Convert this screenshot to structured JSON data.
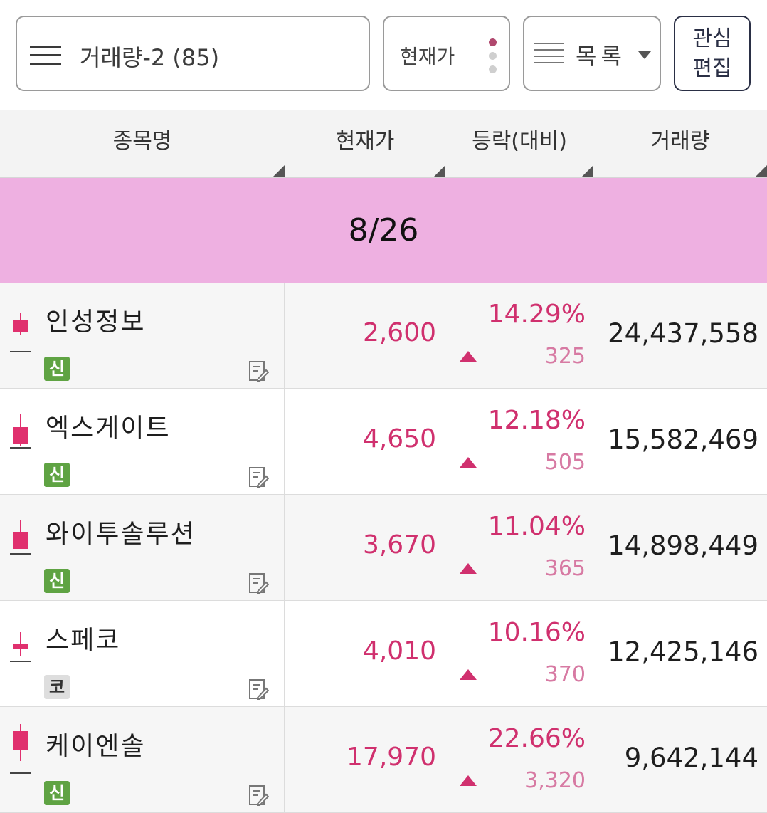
{
  "toolbar": {
    "group_label": "거래량-2 (85)",
    "price_label": "현재가",
    "view_label": "목록",
    "edit_label": "관심\n편집"
  },
  "table_header": {
    "name": "종목명",
    "price": "현재가",
    "change": "등락(대비)",
    "volume": "거래량"
  },
  "date_group": "8/26",
  "colors": {
    "up": "#d0306e",
    "date_band": "#eeb0e1",
    "badge_green": "#5fa343"
  },
  "stocks": [
    {
      "name": "인성정보",
      "badge": "신",
      "badge_type": "green",
      "price": "2,600",
      "change_pct": "14.29%",
      "change_amt": "325",
      "volume": "24,437,558"
    },
    {
      "name": "엑스게이트",
      "badge": "신",
      "badge_type": "green",
      "price": "4,650",
      "change_pct": "12.18%",
      "change_amt": "505",
      "volume": "15,582,469"
    },
    {
      "name": "와이투솔루션",
      "badge": "신",
      "badge_type": "green",
      "price": "3,670",
      "change_pct": "11.04%",
      "change_amt": "365",
      "volume": "14,898,449"
    },
    {
      "name": "스페코",
      "badge": "코",
      "badge_type": "gray",
      "price": "4,010",
      "change_pct": "10.16%",
      "change_amt": "370",
      "volume": "12,425,146"
    },
    {
      "name": "케이엔솔",
      "badge": "신",
      "badge_type": "green",
      "price": "17,970",
      "change_pct": "22.66%",
      "change_amt": "3,320",
      "volume": "9,642,144"
    }
  ]
}
